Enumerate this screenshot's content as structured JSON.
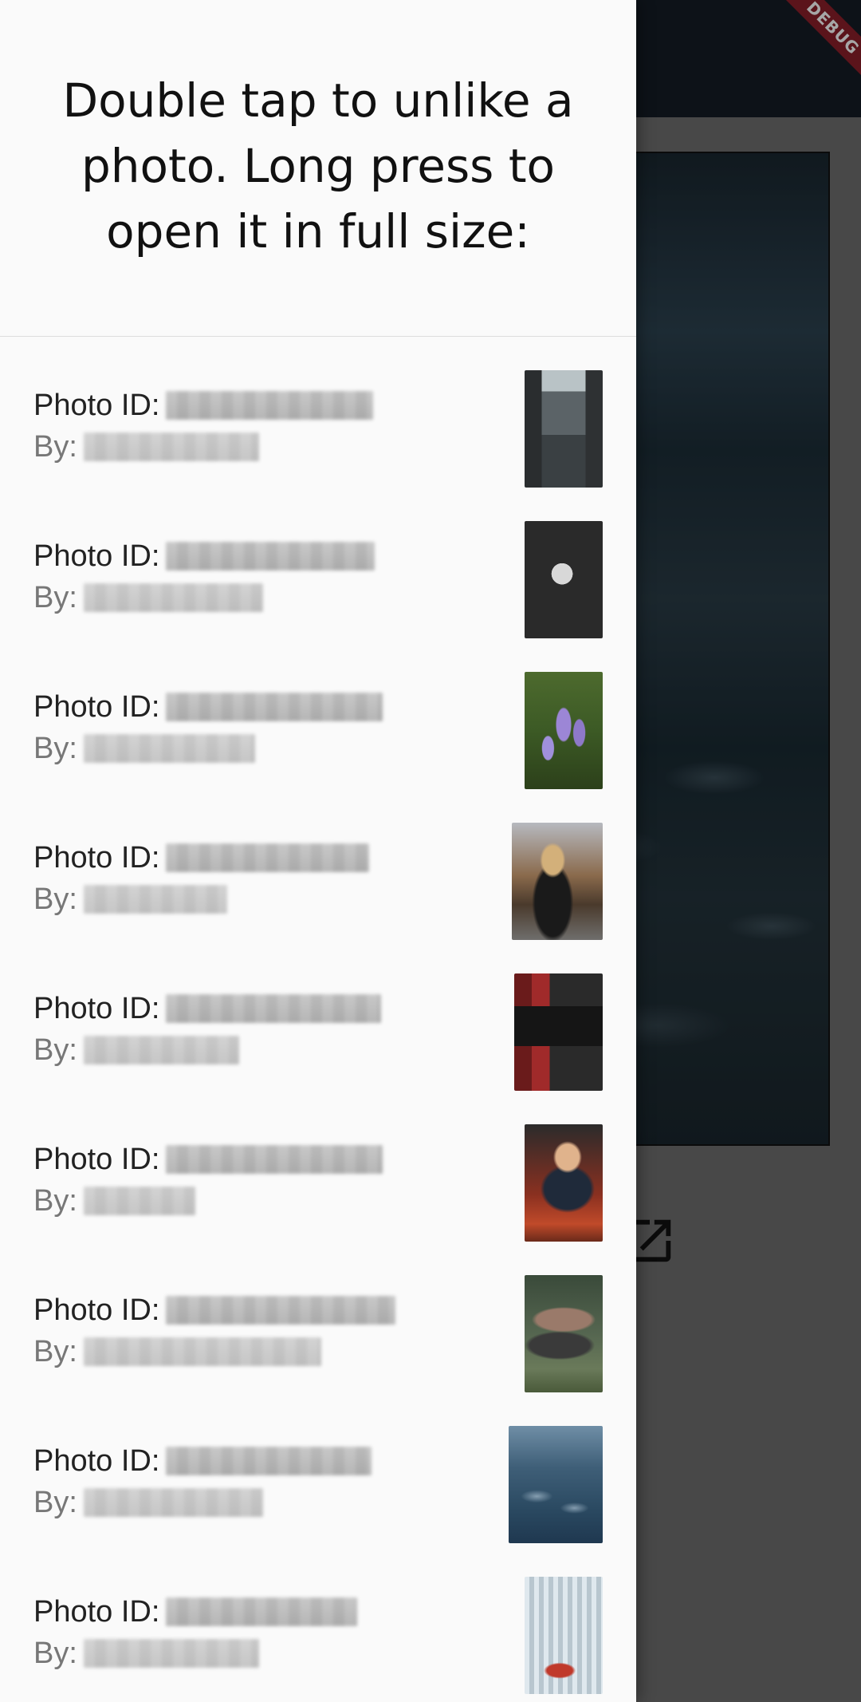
{
  "drawer": {
    "title": "Double tap to unlike a photo. Long press to open it in full size:",
    "photo_id_label": "Photo ID:",
    "by_label": "By:",
    "items": [
      {
        "thumb": "street-photo"
      },
      {
        "thumb": "camera-photo"
      },
      {
        "thumb": "flowers-photo"
      },
      {
        "thumb": "woman-photo"
      },
      {
        "thumb": "computer-photo"
      },
      {
        "thumb": "child-photo"
      },
      {
        "thumb": "jeep-photo"
      },
      {
        "thumb": "sea-photo"
      },
      {
        "thumb": "city-photo"
      }
    ]
  },
  "background": {
    "debug_banner": "DEBUG",
    "open_icon": "open-in-new-icon"
  },
  "colors": {
    "drawer_bg": "#fafafa",
    "appbar_bg": "#141c26",
    "debug_banner": "#8c1f2a"
  }
}
